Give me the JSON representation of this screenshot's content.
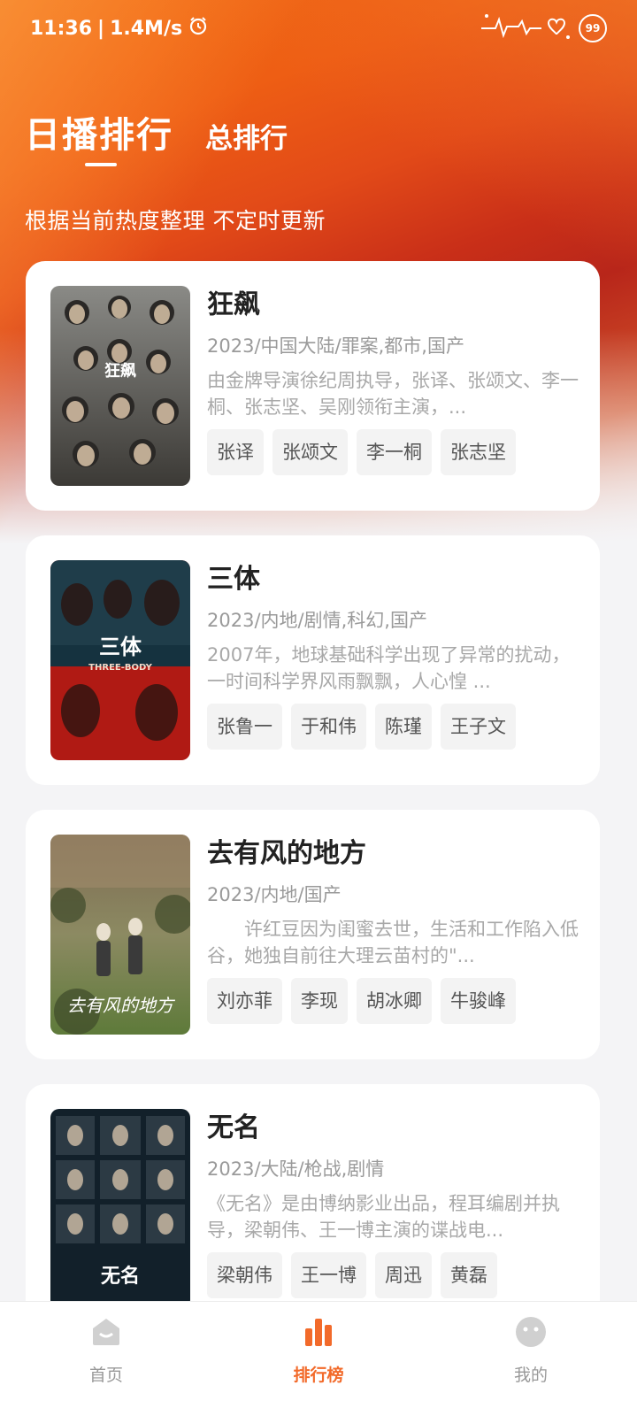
{
  "status": {
    "time": "11:36",
    "speed": "1.4M/s",
    "battery": "99"
  },
  "tabs": {
    "daily": "日播排行",
    "total": "总排行"
  },
  "subtitle": "根据当前热度整理 不定时更新",
  "colors": {
    "accent": "#f26a2a",
    "hero": "#e04818"
  },
  "items": [
    {
      "title": "狂飙",
      "meta": "2023/中国大陆/罪案,都市,国产",
      "desc": "由金牌导演徐纪周执导，张译、张颂文、李一桐、张志坚、吴刚领衔主演，...",
      "tags": [
        "张译",
        "张颂文",
        "李一桐",
        "张志坚"
      ],
      "poster_text": "狂飙"
    },
    {
      "title": "三体",
      "meta": "2023/内地/剧情,科幻,国产",
      "desc": "2007年，地球基础科学出现了异常的扰动，一时间科学界风雨飘飘，人心惶 ...",
      "tags": [
        "张鲁一",
        "于和伟",
        "陈瑾",
        "王子文"
      ],
      "poster_text": "三体",
      "poster_sub": "THREE-BODY"
    },
    {
      "title": "去有风的地方",
      "meta": "2023/内地/国产",
      "desc": "　　许红豆因为闺蜜去世，生活和工作陷入低谷，她独自前往大理云苗村的\"...",
      "tags": [
        "刘亦菲",
        "李现",
        "胡冰卿",
        "牛骏峰"
      ],
      "poster_text": "去有风的地方"
    },
    {
      "title": "无名",
      "meta": "2023/大陆/枪战,剧情",
      "desc": "《无名》是由博纳影业出品，程耳编剧并执导，梁朝伟、王一博主演的谍战电...",
      "tags": [
        "梁朝伟",
        "王一博",
        "周迅",
        "黄磊"
      ],
      "poster_text": "无名"
    }
  ],
  "nav": {
    "home": "首页",
    "rank": "排行榜",
    "mine": "我的"
  }
}
